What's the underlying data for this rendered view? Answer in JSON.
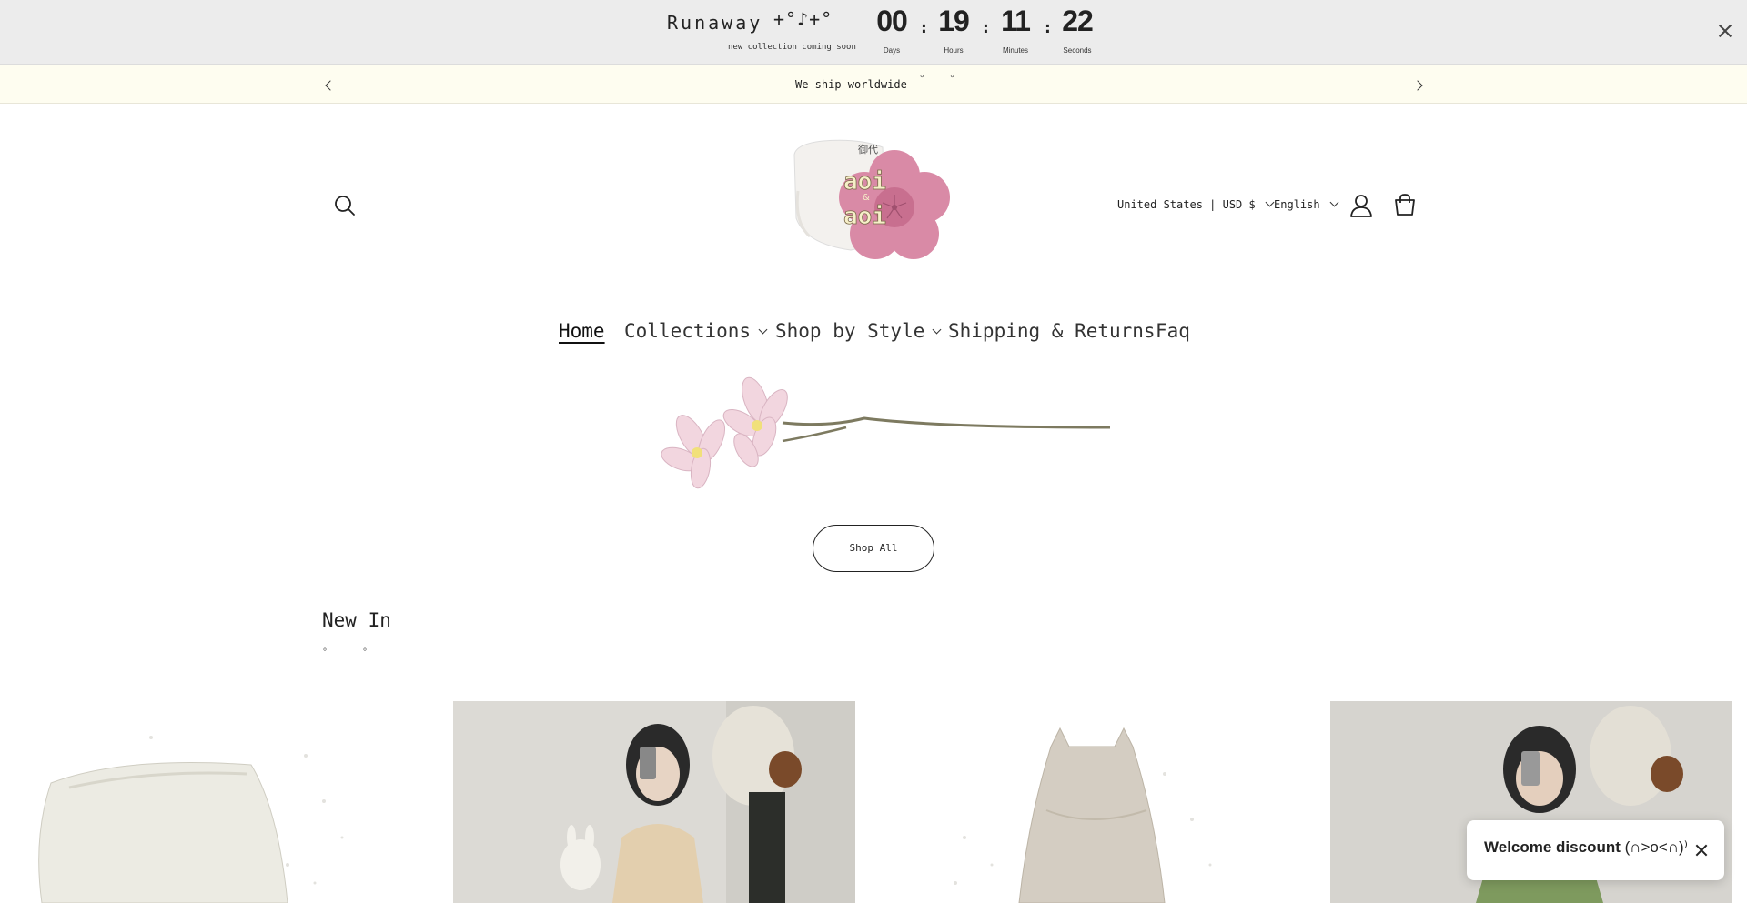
{
  "countdown": {
    "title": "Runaway",
    "sparkle": "+°♪+°",
    "subtitle": "new collection coming soon",
    "days": "00",
    "days_label": "Days",
    "hours": "19",
    "hours_label": "Hours",
    "minutes": "11",
    "minutes_label": "Minutes",
    "seconds": "22",
    "seconds_label": "Seconds",
    "separator": ":"
  },
  "announcement": {
    "text": "We ship worldwide",
    "deco": "° °"
  },
  "header": {
    "logo_text_top": "aoi",
    "logo_text_bottom": "aoi",
    "logo_kanji": "御代",
    "country": "United States | USD $",
    "language": "English"
  },
  "nav": {
    "items": [
      {
        "label": "Home"
      },
      {
        "label": "Collections"
      },
      {
        "label": "Shop by Style"
      },
      {
        "label": "Shipping & Returns"
      },
      {
        "label": "Faq"
      }
    ]
  },
  "hero": {
    "shop_all": "Shop All"
  },
  "new_in": {
    "title": "New In",
    "deco": "° °"
  },
  "welcome": {
    "text": "Welcome discount",
    "face": "(∩>o<∩)⁾"
  },
  "colors": {
    "countdown_bg": "#ececec",
    "announce_bg": "#fefdf0",
    "logo_pink": "#d98aa6"
  }
}
